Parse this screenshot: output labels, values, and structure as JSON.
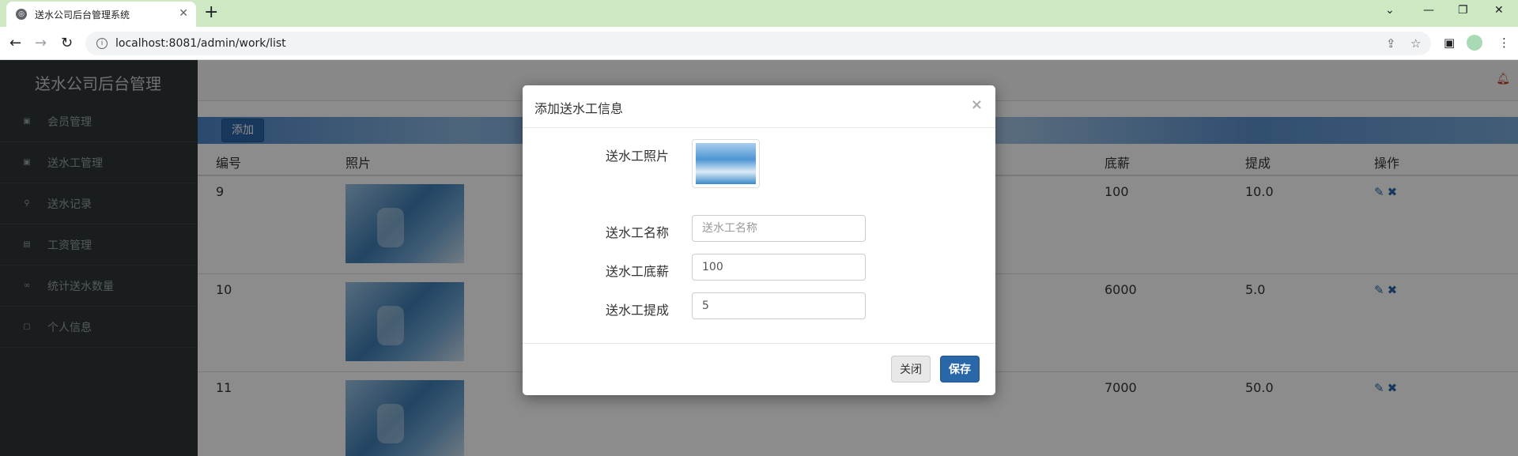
{
  "browser": {
    "tab_title": "送水公司后台管理系统",
    "url": "localhost:8081/admin/work/list"
  },
  "app": {
    "brand": "送水公司后台管理",
    "menu": [
      {
        "label": "会员管理",
        "icon": "user-icon"
      },
      {
        "label": "送水工管理",
        "icon": "id-card-icon"
      },
      {
        "label": "送水记录",
        "icon": "run-icon"
      },
      {
        "label": "工资管理",
        "icon": "card-icon"
      },
      {
        "label": "统计送水数量",
        "icon": "chart-icon"
      },
      {
        "label": "个人信息",
        "icon": "lock-icon"
      }
    ],
    "add_button": "添加",
    "table": {
      "headers": [
        "编号",
        "照片",
        "底薪",
        "提成",
        "操作"
      ],
      "rows": [
        {
          "id": "9",
          "salary": "100",
          "commission": "10.0"
        },
        {
          "id": "10",
          "salary": "6000",
          "commission": "5.0"
        },
        {
          "id": "11",
          "salary": "7000",
          "commission": "50.0"
        }
      ]
    }
  },
  "modal": {
    "title": "添加送水工信息",
    "photo_label": "送水工照片",
    "name_label": "送水工名称",
    "name_placeholder": "送水工名称",
    "name_value": "",
    "salary_label": "送水工底薪",
    "salary_value": "100",
    "commission_label": "送水工提成",
    "commission_value": "5",
    "close_button": "关闭",
    "save_button": "保存"
  },
  "colors": {
    "tabbar": "#cde8c3",
    "sidebar": "#2f3537",
    "primary": "#2a67a8"
  }
}
